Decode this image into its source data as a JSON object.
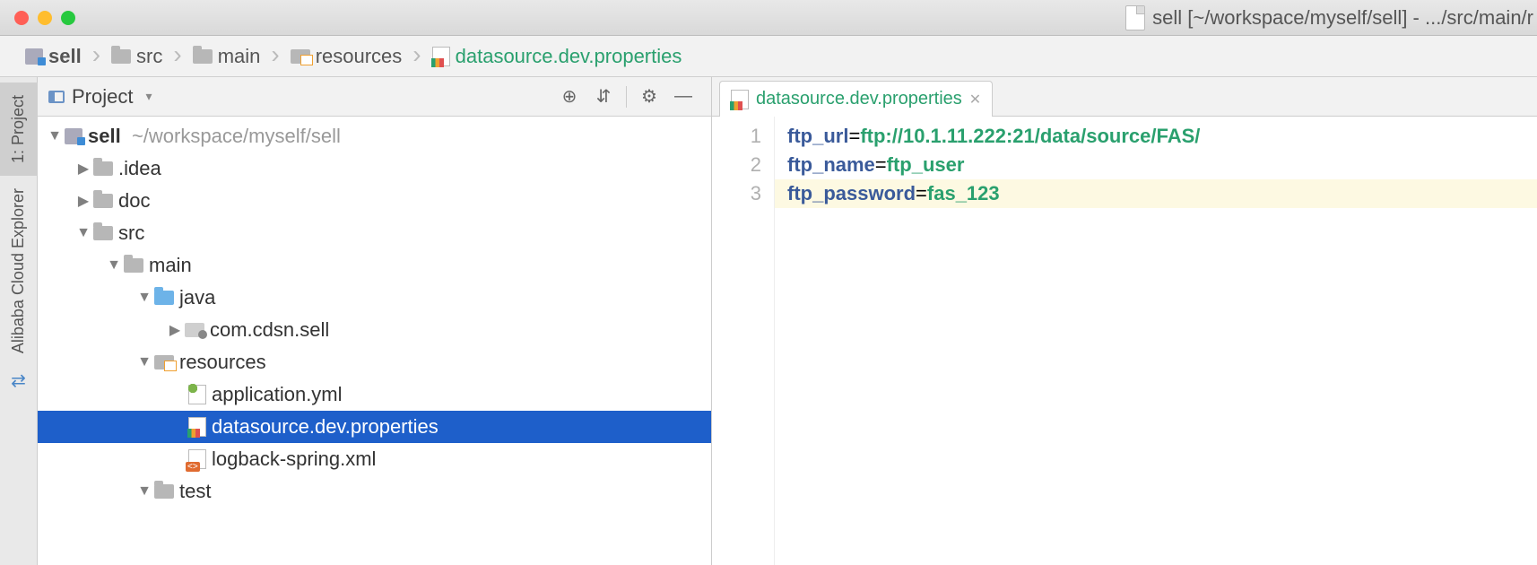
{
  "window": {
    "title": "sell [~/workspace/myself/sell] - .../src/main/r"
  },
  "breadcrumbs": {
    "b0": "sell",
    "b1": "src",
    "b2": "main",
    "b3": "resources",
    "b4": "datasource.dev.properties"
  },
  "gutter": {
    "project": "1: Project",
    "alibaba": "Alibaba Cloud Explorer"
  },
  "panel": {
    "title": "Project"
  },
  "tree": {
    "root": "sell",
    "rootPath": "~/workspace/myself/sell",
    "idea": ".idea",
    "doc": "doc",
    "src": "src",
    "main": "main",
    "java": "java",
    "pkg": "com.cdsn.sell",
    "resources": "resources",
    "appyml": "application.yml",
    "dsprops": "datasource.dev.properties",
    "logback": "logback-spring.xml",
    "test": "test"
  },
  "tab": {
    "name": "datasource.dev.properties"
  },
  "code": {
    "ln1": "1",
    "ln2": "2",
    "ln3": "3",
    "k1": "ftp_url",
    "v1": "ftp://10.1.11.222:21/data/source/FAS/",
    "k2": "ftp_name",
    "v2": "ftp_user",
    "k3": "ftp_password",
    "v3": "fas_123",
    "eq": "="
  }
}
